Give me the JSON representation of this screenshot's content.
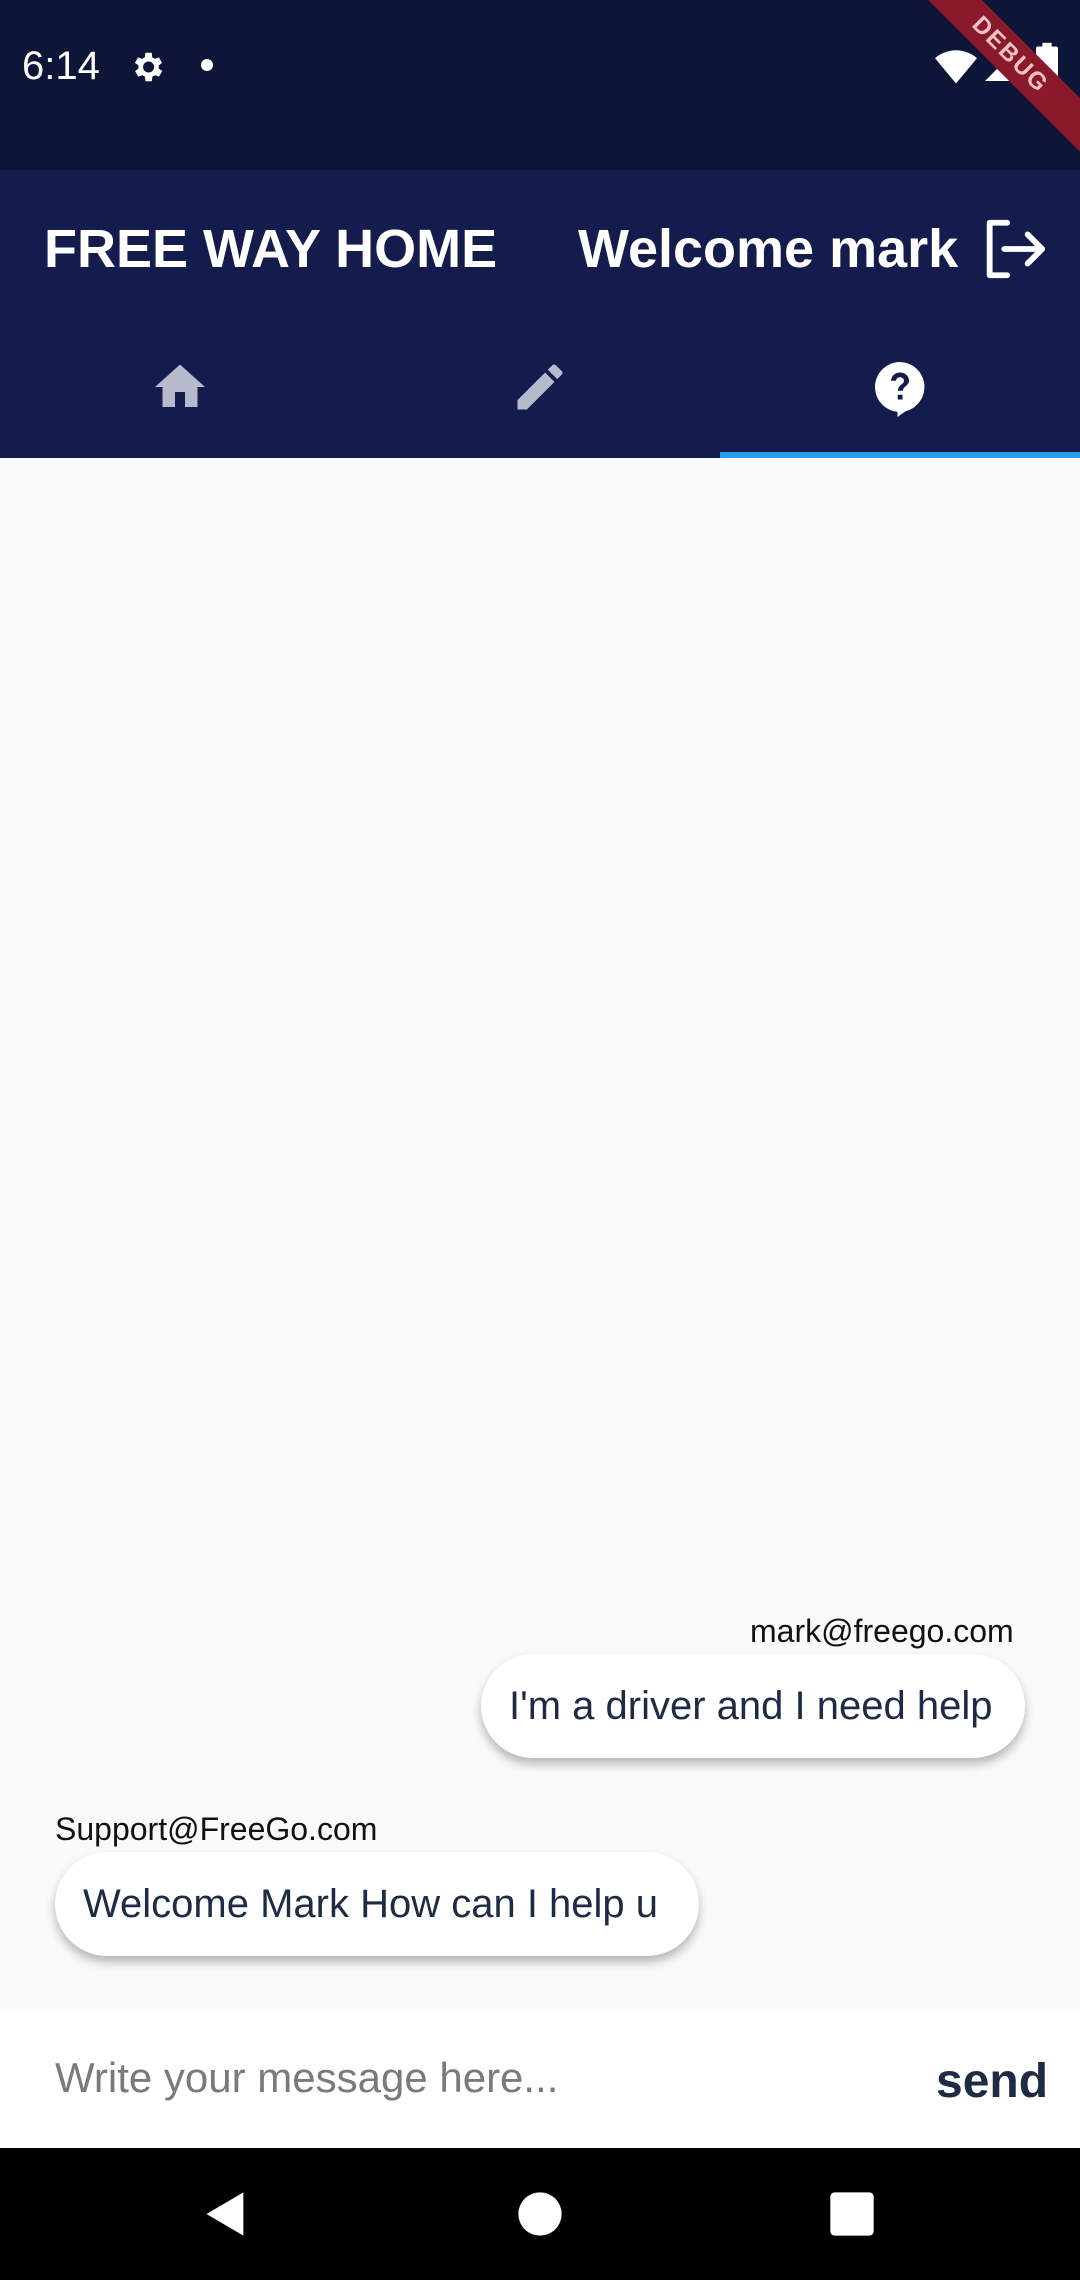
{
  "status_bar": {
    "time": "6:14",
    "debug_banner": "DEBUG",
    "icons": [
      "gear-icon",
      "dot-icon",
      "wifi-icon",
      "signal-icon",
      "battery-icon"
    ]
  },
  "app_bar": {
    "title": "FREE WAY HOME",
    "welcome": "Welcome mark",
    "logout_icon": "logout-icon",
    "colors": {
      "background": "#141c4d",
      "status_bar": "#0d1539",
      "tab_indicator": "#2d9cf0"
    }
  },
  "tabs": [
    {
      "icon": "home-icon",
      "active": false
    },
    {
      "icon": "edit-icon",
      "active": false
    },
    {
      "icon": "help-icon",
      "active": true
    }
  ],
  "messages": [
    {
      "sender": "mark@freego.com",
      "text": "I'm a driver and I need help",
      "align": "right"
    },
    {
      "sender": "Support@FreeGo.com",
      "text": "Welcome Mark How can I help u",
      "align": "left"
    }
  ],
  "composer": {
    "placeholder": "Write your message here...",
    "value": "",
    "send_label": "send"
  },
  "nav_bar": {
    "icons": [
      "back-icon",
      "home-circle-icon",
      "recents-icon"
    ]
  }
}
